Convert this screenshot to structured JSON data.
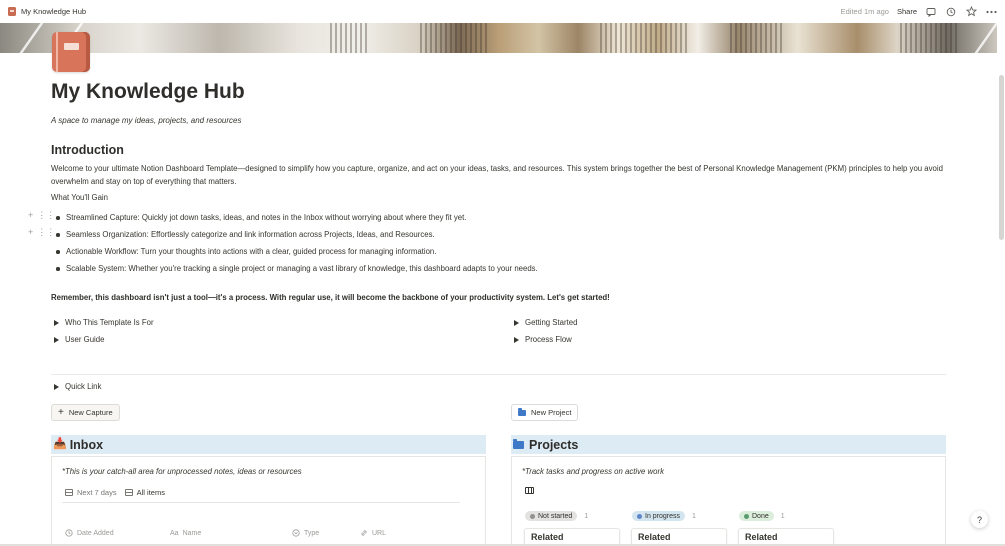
{
  "topbar": {
    "breadcrumb": "My Knowledge Hub",
    "edited": "Edited 1m ago",
    "share": "Share",
    "icons": [
      "comment-icon",
      "clock-icon",
      "star-icon",
      "more-icon"
    ]
  },
  "page": {
    "title": "My Knowledge Hub",
    "subtitle": "A space to manage my ideas, projects, and resources",
    "icon": "book-icon"
  },
  "intro": {
    "heading": "Introduction",
    "paragraph": "Welcome to your ultimate Notion Dashboard Template—designed to simplify how you capture, organize, and act on your ideas, tasks, and resources. This system brings together the best of Personal Knowledge Management (PKM) principles to help you avoid overwhelm and stay on top of everything that matters.",
    "gain_label": "What You'll Gain",
    "bullets": [
      "Streamlined Capture: Quickly jot down tasks, ideas, and notes in the Inbox without worrying about where they fit yet.",
      "Seamless Organization: Effortlessly categorize and link information across Projects, Ideas, and Resources.",
      "Actionable Workflow: Turn your thoughts into actions with a clear, guided process for managing information.",
      "Scalable System: Whether you're tracking a single project or managing a vast library of knowledge, this dashboard adapts to your needs."
    ],
    "remember": "Remember, this dashboard isn't just a tool—it's a process. With regular use, it will become the backbone of your productivity system. Let's get started!"
  },
  "toggles": {
    "left": [
      "Who This Template Is For",
      "User Guide"
    ],
    "right": [
      "Getting Started",
      "Process Flow"
    ],
    "quick_link": "Quick Link"
  },
  "buttons": {
    "new_capture": "New Capture",
    "new_project": "New Project"
  },
  "inbox": {
    "heading": "Inbox",
    "note": "*This is your catch-all area for unprocessed notes, ideas or resources",
    "views": [
      "Next 7 days",
      "All items"
    ],
    "active_view": "All items",
    "columns": [
      "Date Added",
      "Name",
      "Type",
      "URL"
    ],
    "column_icon_names": [
      "clock-icon",
      "text-icon",
      "select-icon",
      "link-icon"
    ]
  },
  "projects": {
    "heading": "Projects",
    "note": "*Track tasks and progress on active work",
    "groups": [
      {
        "label": "Not started",
        "count": "1",
        "color": "#91918e",
        "bg": "#e3e2e0"
      },
      {
        "label": "In progress",
        "count": "1",
        "color": "#5e87c9",
        "bg": "#d3e5ef"
      },
      {
        "label": "Done",
        "count": "1",
        "color": "#5b9a6e",
        "bg": "#dbeddb"
      }
    ],
    "cards": [
      "Related",
      "Related",
      "Related"
    ]
  },
  "colors": {
    "accent_band": "#ddebf5",
    "text": "#37352f"
  }
}
